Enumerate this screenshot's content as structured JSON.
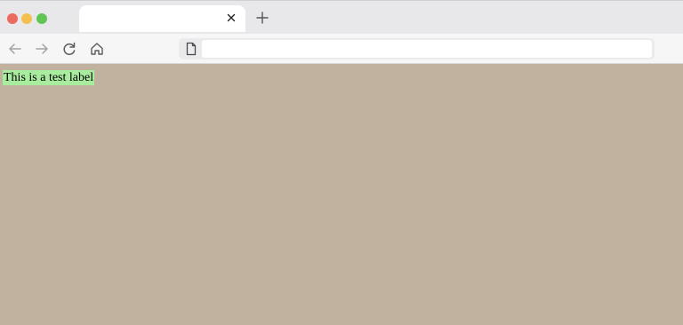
{
  "browser": {
    "tab": {
      "title": "",
      "close_icon": "close-icon"
    },
    "new_tab_icon": "plus-icon",
    "toolbar": {
      "back_icon": "arrow-left-icon",
      "forward_icon": "arrow-right-icon",
      "reload_icon": "reload-icon",
      "home_icon": "home-icon"
    },
    "address_bar": {
      "value": "",
      "page_icon": "page-icon"
    }
  },
  "page": {
    "label_text": "This is a test label",
    "background_color": "#c1b29f",
    "label_background_color": "#a8ec9e"
  }
}
